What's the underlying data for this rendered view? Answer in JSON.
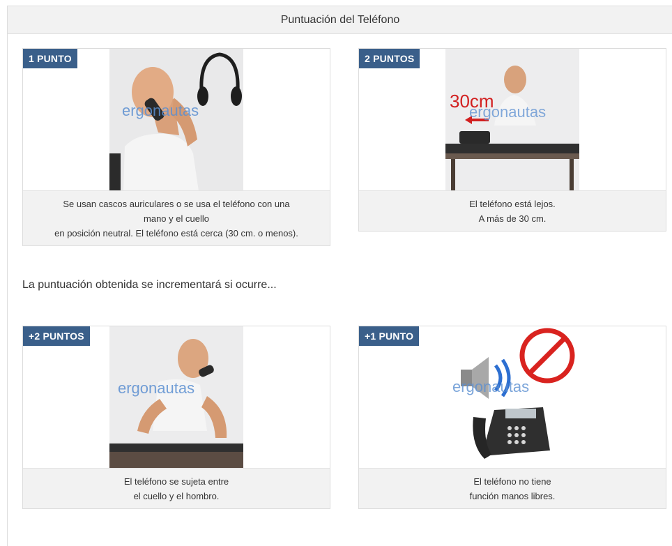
{
  "header": {
    "title": "Puntuación del Teléfono"
  },
  "cards_top": [
    {
      "badge": "1 PUNTO",
      "caption": [
        "Se usan cascos auriculares o se usa el teléfono con una",
        "mano y el cuello",
        "en posición neutral. El teléfono está cerca (30 cm. o menos)."
      ]
    },
    {
      "badge": "2 PUNTOS",
      "image_label": "30cm",
      "caption": [
        "El teléfono está lejos.",
        "A más de 30 cm."
      ]
    }
  ],
  "note": "La puntuación obtenida se incrementará si ocurre...",
  "cards_bottom": [
    {
      "badge": "+2 PUNTOS",
      "caption": [
        "El teléfono se sujeta entre",
        "el cuello y el hombro."
      ]
    },
    {
      "badge": "+1 PUNTO",
      "caption": [
        "El teléfono no tiene",
        "función manos libres."
      ]
    }
  ],
  "watermark": "ergonautas",
  "colors": {
    "badge": "#3a5f8a",
    "header_bg": "#f2f2f2",
    "caption_bg": "#f2f2f2"
  }
}
